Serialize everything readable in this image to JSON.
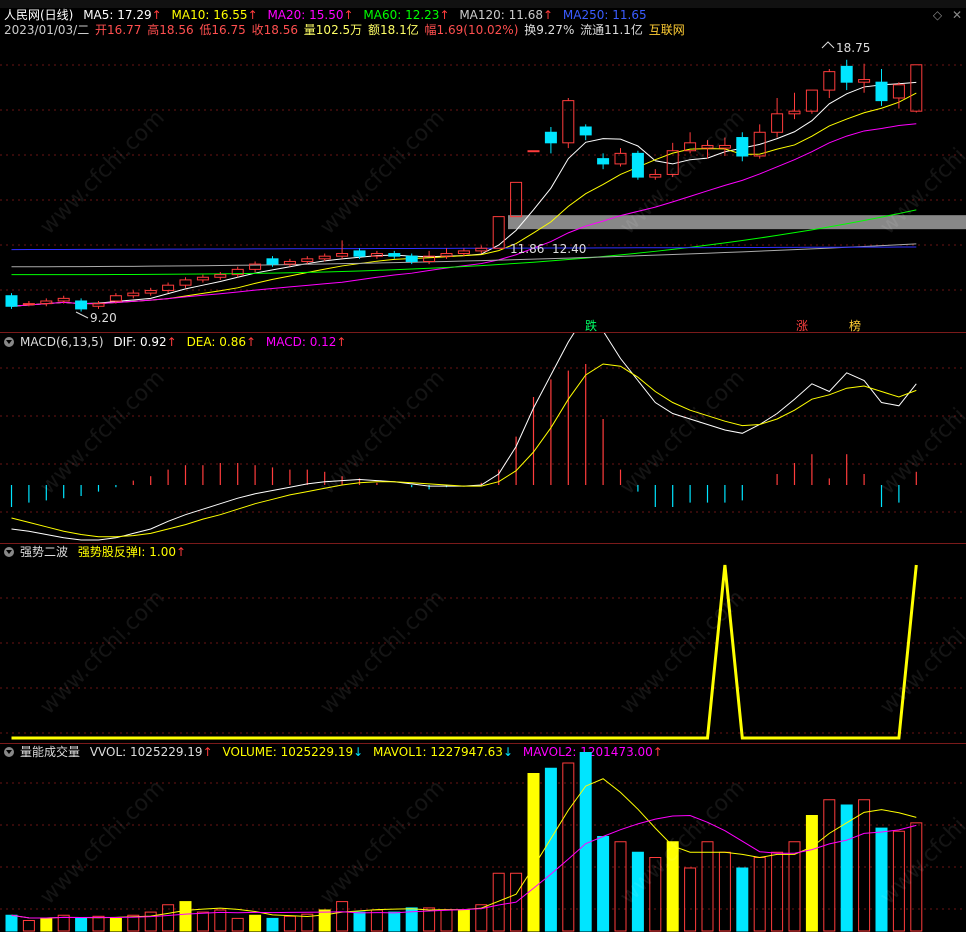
{
  "main": {
    "stock_name": "人民网(日线)",
    "ma5": "MA5: 17.29",
    "ma10": "MA10: 16.55",
    "ma20": "MA20: 15.50",
    "ma60": "MA60: 12.23",
    "ma120": "MA120: 11.68",
    "ma250": "MA250: 11.65",
    "date": "2023/01/03/二",
    "open": "开16.77",
    "high": "高18.56",
    "low": "低16.75",
    "close": "收18.56",
    "volume": "量102.5万",
    "amount": "额18.1亿",
    "change": "幅1.69(10.02%)",
    "turnover": "换9.27%",
    "float": "流通11.1亿",
    "concept": "互联网",
    "peak_label": "18.75",
    "low_label": "9.20",
    "level1": "11.86",
    "level2": "12.40",
    "tag_die": "跌",
    "tag_zhang": "涨",
    "tag_bang": "榜",
    "colors": {
      "up": "#ff3c3c",
      "down": "#00e5ff",
      "ma5": "#ffffff",
      "ma10": "#ffff00",
      "ma20": "#ff00ff",
      "ma60": "#00ff00",
      "ma120": "#aaaaaa",
      "ma250": "#3030ff"
    }
  },
  "macd": {
    "title": "MACD(6,13,5)",
    "dif": "DIF: 0.92",
    "dea": "DEA: 0.86",
    "macd": "MACD: 0.12"
  },
  "wave": {
    "title": "强势二波",
    "value": "强势股反弹I: 1.00"
  },
  "vol": {
    "title": "量能成交量",
    "vvol": "VVOL: 1025229.19",
    "volume": "VOLUME: 1025229.19",
    "mavol1": "MAVOL1: 1227947.63",
    "mavol2": "MAVOL2: 1201473.00"
  },
  "watermark": "www.cfchi.com",
  "chart_data": {
    "type": "candlestick",
    "title": "人民网(日线)",
    "candles": [
      {
        "o": 9.8,
        "c": 9.4,
        "h": 9.9,
        "l": 9.3
      },
      {
        "o": 9.5,
        "c": 9.5,
        "h": 9.6,
        "l": 9.4
      },
      {
        "o": 9.5,
        "c": 9.6,
        "h": 9.7,
        "l": 9.4
      },
      {
        "o": 9.6,
        "c": 9.7,
        "h": 9.8,
        "l": 9.5
      },
      {
        "o": 9.6,
        "c": 9.3,
        "h": 9.7,
        "l": 9.2
      },
      {
        "o": 9.4,
        "c": 9.5,
        "h": 9.6,
        "l": 9.3
      },
      {
        "o": 9.6,
        "c": 9.8,
        "h": 9.9,
        "l": 9.5
      },
      {
        "o": 9.8,
        "c": 9.9,
        "h": 10.0,
        "l": 9.7
      },
      {
        "o": 9.9,
        "c": 10.0,
        "h": 10.1,
        "l": 9.8
      },
      {
        "o": 10.0,
        "c": 10.2,
        "h": 10.3,
        "l": 9.9
      },
      {
        "o": 10.2,
        "c": 10.4,
        "h": 10.5,
        "l": 10.1
      },
      {
        "o": 10.4,
        "c": 10.5,
        "h": 10.6,
        "l": 10.3
      },
      {
        "o": 10.5,
        "c": 10.6,
        "h": 10.7,
        "l": 10.4
      },
      {
        "o": 10.6,
        "c": 10.8,
        "h": 10.9,
        "l": 10.5
      },
      {
        "o": 10.8,
        "c": 11.0,
        "h": 11.1,
        "l": 10.7
      },
      {
        "o": 11.2,
        "c": 11.0,
        "h": 11.3,
        "l": 10.9
      },
      {
        "o": 11.0,
        "c": 11.1,
        "h": 11.2,
        "l": 10.9
      },
      {
        "o": 11.1,
        "c": 11.2,
        "h": 11.3,
        "l": 11.0
      },
      {
        "o": 11.2,
        "c": 11.3,
        "h": 11.4,
        "l": 11.1
      },
      {
        "o": 11.3,
        "c": 11.4,
        "h": 11.9,
        "l": 11.2
      },
      {
        "o": 11.5,
        "c": 11.3,
        "h": 11.6,
        "l": 11.2
      },
      {
        "o": 11.3,
        "c": 11.4,
        "h": 11.5,
        "l": 11.2
      },
      {
        "o": 11.4,
        "c": 11.3,
        "h": 11.5,
        "l": 11.2
      },
      {
        "o": 11.3,
        "c": 11.1,
        "h": 11.4,
        "l": 11.0
      },
      {
        "o": 11.1,
        "c": 11.3,
        "h": 11.5,
        "l": 11.0
      },
      {
        "o": 11.3,
        "c": 11.4,
        "h": 11.6,
        "l": 11.2
      },
      {
        "o": 11.4,
        "c": 11.5,
        "h": 11.6,
        "l": 11.3
      },
      {
        "o": 11.5,
        "c": 11.6,
        "h": 11.7,
        "l": 11.4
      },
      {
        "o": 11.6,
        "c": 12.8,
        "h": 12.8,
        "l": 11.6
      },
      {
        "o": 12.8,
        "c": 14.1,
        "h": 14.1,
        "l": 12.8
      },
      {
        "o": 15.3,
        "c": 15.3,
        "h": 15.3,
        "l": 15.3
      },
      {
        "o": 16.0,
        "c": 15.6,
        "h": 16.2,
        "l": 15.2
      },
      {
        "o": 15.6,
        "c": 17.2,
        "h": 17.3,
        "l": 15.4
      },
      {
        "o": 16.2,
        "c": 15.9,
        "h": 16.3,
        "l": 15.7
      },
      {
        "o": 15.0,
        "c": 14.8,
        "h": 15.2,
        "l": 14.6
      },
      {
        "o": 14.8,
        "c": 15.2,
        "h": 15.4,
        "l": 14.7
      },
      {
        "o": 15.2,
        "c": 14.3,
        "h": 15.3,
        "l": 14.2
      },
      {
        "o": 14.3,
        "c": 14.4,
        "h": 14.6,
        "l": 14.2
      },
      {
        "o": 14.4,
        "c": 15.3,
        "h": 15.6,
        "l": 14.3
      },
      {
        "o": 15.3,
        "c": 15.6,
        "h": 16.0,
        "l": 15.2
      },
      {
        "o": 15.4,
        "c": 15.5,
        "h": 15.7,
        "l": 15.0
      },
      {
        "o": 15.4,
        "c": 15.5,
        "h": 15.8,
        "l": 15.1
      },
      {
        "o": 15.8,
        "c": 15.1,
        "h": 16.0,
        "l": 14.9
      },
      {
        "o": 15.1,
        "c": 16.0,
        "h": 16.3,
        "l": 15.0
      },
      {
        "o": 16.0,
        "c": 16.7,
        "h": 17.3,
        "l": 15.8
      },
      {
        "o": 16.7,
        "c": 16.8,
        "h": 17.5,
        "l": 16.5
      },
      {
        "o": 16.8,
        "c": 17.6,
        "h": 17.6,
        "l": 16.7
      },
      {
        "o": 17.6,
        "c": 18.3,
        "h": 18.4,
        "l": 17.3
      },
      {
        "o": 18.5,
        "c": 17.9,
        "h": 18.75,
        "l": 17.6
      },
      {
        "o": 17.9,
        "c": 18.0,
        "h": 18.6,
        "l": 17.5
      },
      {
        "o": 17.9,
        "c": 17.2,
        "h": 18.4,
        "l": 17.0
      },
      {
        "o": 17.3,
        "c": 17.8,
        "h": 17.9,
        "l": 16.9
      },
      {
        "o": 16.8,
        "c": 18.56,
        "h": 18.56,
        "l": 16.75
      }
    ],
    "ylim": [
      8.5,
      19.5
    ],
    "macd_dif": [
      -0.4,
      -0.42,
      -0.45,
      -0.48,
      -0.5,
      -0.5,
      -0.48,
      -0.44,
      -0.4,
      -0.33,
      -0.27,
      -0.22,
      -0.17,
      -0.12,
      -0.08,
      -0.05,
      -0.02,
      0.01,
      0.03,
      0.04,
      0.05,
      0.04,
      0.03,
      0.01,
      -0.01,
      -0.01,
      -0.01,
      0.0,
      0.1,
      0.35,
      0.7,
      1.0,
      1.3,
      1.55,
      1.4,
      1.15,
      0.95,
      0.75,
      0.65,
      0.6,
      0.55,
      0.5,
      0.47,
      0.55,
      0.65,
      0.78,
      0.92,
      0.85,
      1.02,
      0.95,
      0.75,
      0.72,
      0.92
    ],
    "macd_dea": [
      -0.3,
      -0.34,
      -0.38,
      -0.42,
      -0.45,
      -0.47,
      -0.47,
      -0.46,
      -0.44,
      -0.4,
      -0.36,
      -0.31,
      -0.27,
      -0.22,
      -0.17,
      -0.13,
      -0.09,
      -0.06,
      -0.03,
      0.0,
      0.02,
      0.03,
      0.03,
      0.02,
      0.01,
      0.0,
      -0.01,
      -0.01,
      0.03,
      0.13,
      0.3,
      0.52,
      0.78,
      1.0,
      1.1,
      1.08,
      0.98,
      0.85,
      0.75,
      0.68,
      0.63,
      0.58,
      0.54,
      0.55,
      0.6,
      0.68,
      0.78,
      0.82,
      0.88,
      0.9,
      0.85,
      0.8,
      0.86
    ],
    "wave_signal": [
      0,
      0,
      0,
      0,
      0,
      0,
      0,
      0,
      0,
      0,
      0,
      0,
      0,
      0,
      0,
      0,
      0,
      0,
      0,
      0,
      0,
      0,
      0,
      0,
      0,
      0,
      0,
      0,
      0,
      0,
      0,
      0,
      0,
      0,
      0,
      0,
      0,
      0,
      0,
      0,
      0,
      1,
      0,
      0,
      0,
      0,
      0,
      0,
      0,
      0,
      0,
      0,
      1
    ],
    "volumes": [
      0.15,
      0.1,
      0.12,
      0.15,
      0.12,
      0.14,
      0.12,
      0.15,
      0.18,
      0.25,
      0.28,
      0.18,
      0.2,
      0.12,
      0.15,
      0.12,
      0.14,
      0.16,
      0.2,
      0.28,
      0.18,
      0.2,
      0.18,
      0.22,
      0.22,
      0.2,
      0.2,
      0.25,
      0.55,
      0.55,
      1.5,
      1.55,
      1.6,
      1.7,
      0.9,
      0.85,
      0.75,
      0.7,
      0.85,
      0.6,
      0.85,
      0.75,
      0.6,
      0.7,
      0.75,
      0.85,
      1.1,
      1.25,
      1.2,
      1.25,
      0.98,
      0.95,
      1.03
    ]
  }
}
